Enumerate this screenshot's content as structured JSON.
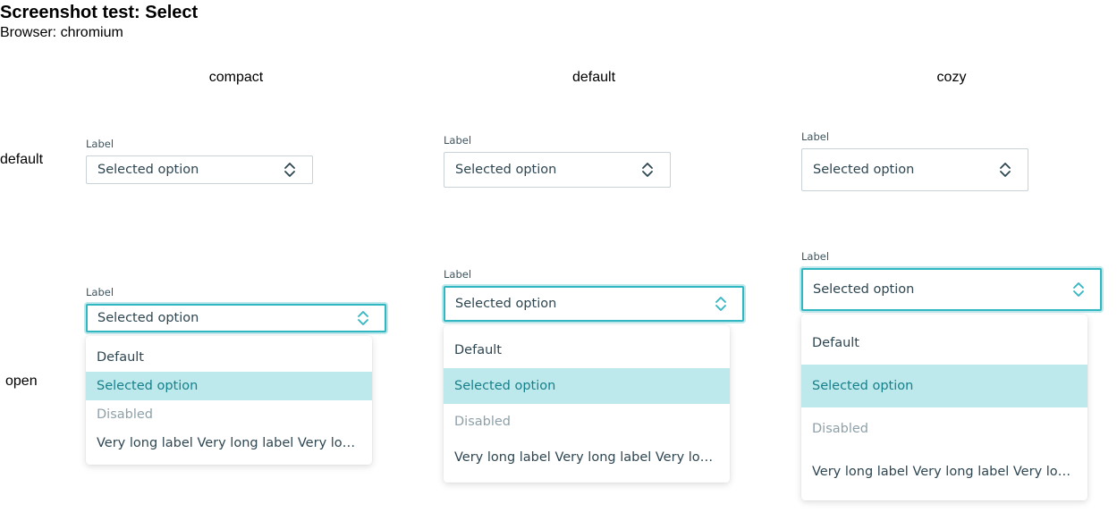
{
  "page": {
    "title": "Screenshot test: Select",
    "subtitle": "Browser: chromium"
  },
  "columns": [
    "compact",
    "default",
    "cozy"
  ],
  "rows": [
    "default",
    "open"
  ],
  "field": {
    "label": "Label",
    "value": "Selected option"
  },
  "options": [
    {
      "label": "Default",
      "state": "normal"
    },
    {
      "label": "Selected option",
      "state": "selected"
    },
    {
      "label": "Disabled",
      "state": "disabled"
    },
    {
      "label": "Very long label Very long label Very long label Very long label",
      "state": "normal"
    }
  ],
  "colors": {
    "accent": "#31b7c2",
    "selected_bg": "#bde9ec",
    "selected_text": "#17808a",
    "text": "#2e4651",
    "disabled_text": "#8ea0a8"
  },
  "icons": {
    "select_chevron": "chevron-up-down-icon"
  }
}
